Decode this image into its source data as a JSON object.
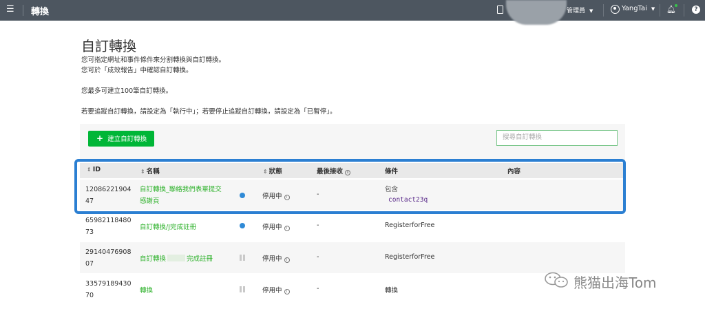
{
  "topbar": {
    "menu_icon": "hamburger-icon",
    "title": "轉換",
    "admin_label": "管理員",
    "user_name": "YangTai"
  },
  "page": {
    "title": "自訂轉換",
    "desc_line1": "您可指定網址和事件條件來分割轉換與自訂轉換。",
    "desc_line2": "您可於「成效報告」中確認自訂轉換。",
    "desc_line3": "您最多可建立100筆自訂轉換。",
    "desc_line4": "若要追蹤自訂轉換，請設定為「執行中」；若要停止追蹤自訂轉換，請設定為「已暫停」。"
  },
  "toolbar": {
    "create_label": "建立自訂轉換",
    "search_placeholder": "搜尋自訂轉換"
  },
  "table": {
    "headers": {
      "id": "ID",
      "name": "名稱",
      "status": "狀態",
      "last": "最後接收",
      "cond": "條件",
      "content": "內容"
    },
    "rows": [
      {
        "id_a": "12086221904",
        "id_b": "47",
        "name_a": "自訂轉換_聯絡我們表單提交",
        "name_b": "感謝頁",
        "status": "停用中",
        "last": "-",
        "cond_a": "包含",
        "cond_b": "contact23q",
        "state": "on"
      },
      {
        "id_a": "65982118480",
        "id_b": "73",
        "name_a": "自訂轉換/J完成註冊",
        "status": "停用中",
        "last": "-",
        "cond_a": "RegisterforFree",
        "state": "on"
      },
      {
        "id_a": "29140476908",
        "id_b": "07",
        "name_a": "自訂轉換",
        "name_c": "完成註冊",
        "status": "停用中",
        "last": "-",
        "cond_a": "RegisterforFree",
        "state": "paused"
      },
      {
        "id_a": "33579189430",
        "id_b": "70",
        "name_a": "轉換",
        "status": "停用中",
        "last": "-",
        "cond_a": "轉換",
        "state": "paused"
      }
    ]
  },
  "watermark": {
    "text": "熊猫出海Tom"
  },
  "colors": {
    "accent_green": "#00b637",
    "link_green": "#2fb22c",
    "highlight_blue": "#2b7fd2",
    "topbar": "#4d5660"
  }
}
